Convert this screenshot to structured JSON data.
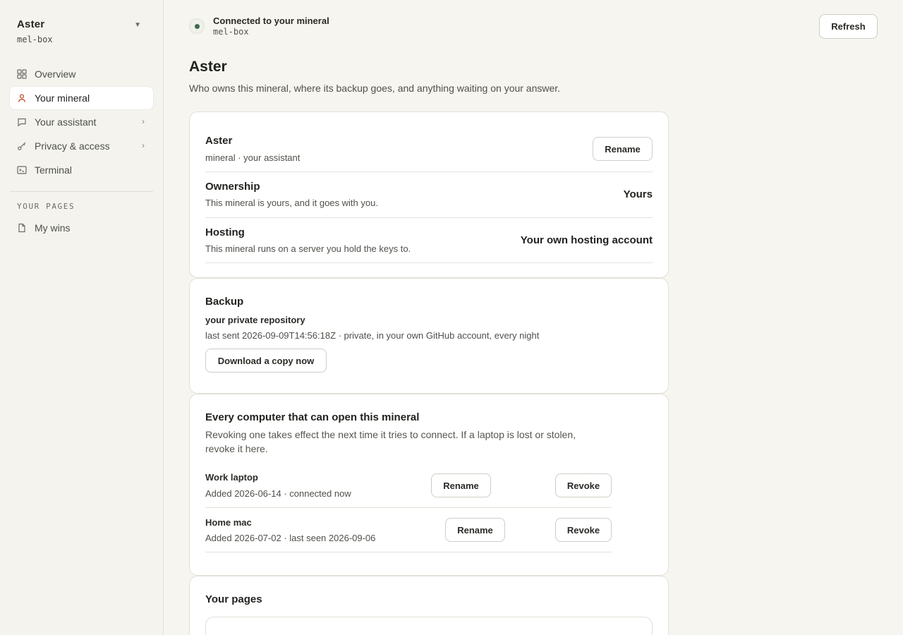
{
  "workspace": {
    "name": "Aster",
    "host": "mel-box"
  },
  "sidebar": {
    "items": [
      {
        "label": "Overview"
      },
      {
        "label": "Your mineral"
      },
      {
        "label": "Your assistant"
      },
      {
        "label": "Privacy & access"
      },
      {
        "label": "Terminal"
      }
    ],
    "section_label": "YOUR PAGES",
    "pages": [
      {
        "label": "My wins"
      }
    ]
  },
  "topbar": {
    "status": "Connected to your mineral",
    "host": "mel-box",
    "refresh_label": "Refresh"
  },
  "page": {
    "title": "Aster",
    "description": "Who owns this mineral, where its backup goes, and anything waiting on your answer."
  },
  "identity_card": {
    "name": "Aster",
    "subtitle": "mineral · your assistant",
    "rename_label": "Rename",
    "ownership": {
      "title": "Ownership",
      "desc": "This mineral is yours, and it goes with you.",
      "value": "Yours"
    },
    "hosting": {
      "title": "Hosting",
      "desc": "This mineral runs on a server you hold the keys to.",
      "value": "Your own hosting account"
    }
  },
  "backup_card": {
    "title": "Backup",
    "destination": "your private repository",
    "detail": "last sent 2026-09-09T14:56:18Z · private, in your own GitHub account, every night",
    "download_label": "Download a copy now"
  },
  "devices_card": {
    "title": "Every computer that can open this mineral",
    "description": "Revoking one takes effect the next time it tries to connect. If a laptop is lost or stolen, revoke it here.",
    "devices": [
      {
        "name": "Work laptop",
        "detail": "Added 2026-06-14 · connected now",
        "rename_label": "Rename",
        "revoke_label": "Revoke"
      },
      {
        "name": "Home mac",
        "detail": "Added 2026-07-02 · last seen 2026-09-06",
        "rename_label": "Rename",
        "revoke_label": "Revoke"
      }
    ]
  },
  "pages_card": {
    "title": "Your pages"
  },
  "colors": {
    "accent": "#c0502e",
    "status_ok": "#3f6b4a",
    "background": "#f6f5f0"
  }
}
